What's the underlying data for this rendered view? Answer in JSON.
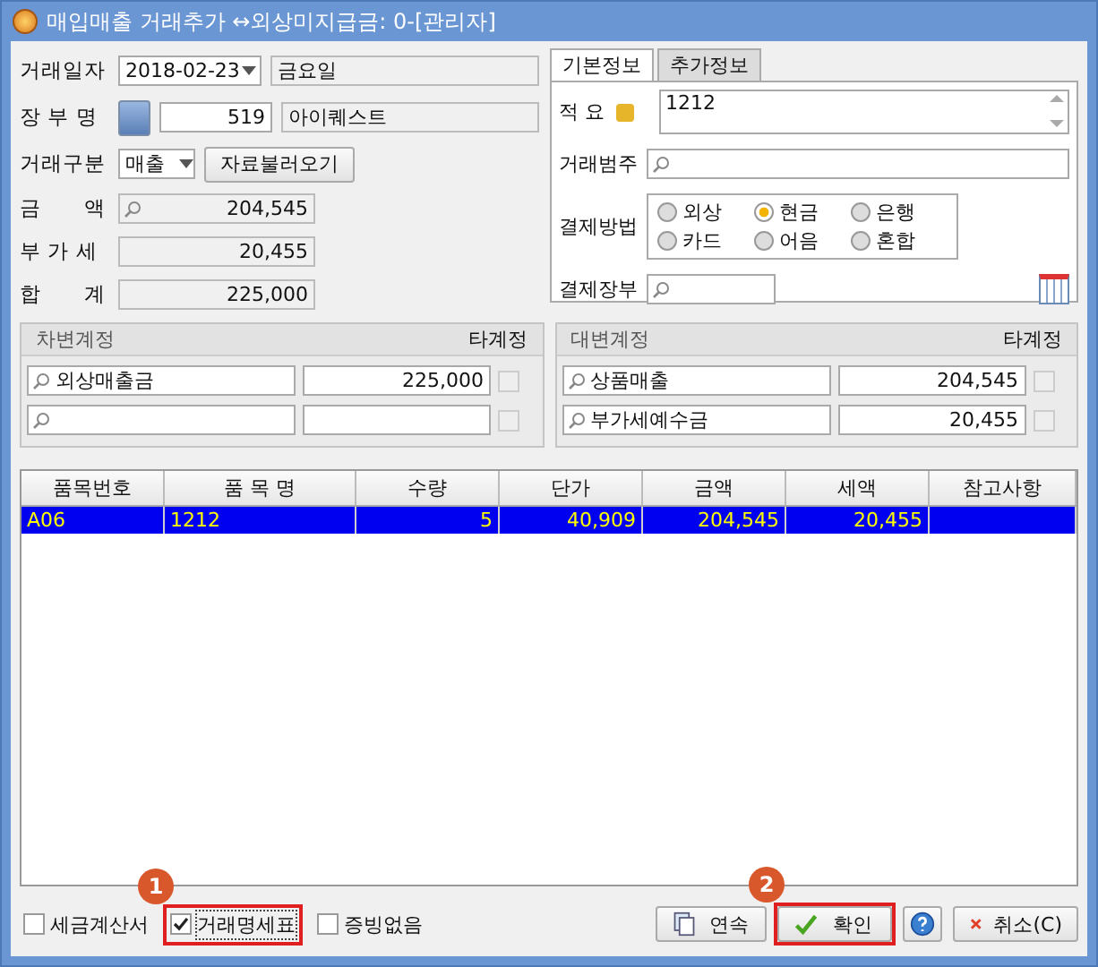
{
  "window": {
    "title": "매입매출 거래추가 ↔외상미지급금: 0-[관리자]"
  },
  "left": {
    "date_label": "거래일자",
    "date": "2018-02-23",
    "weekday": "금요일",
    "ledger_label": "장 부 명",
    "ledger_code": "519",
    "ledger_name": "아이퀘스트",
    "type_label": "거래구분",
    "type": "매출",
    "load_button": "자료불러오기",
    "amounts": [
      {
        "label": "금　　액",
        "value": "204,545",
        "search": true
      },
      {
        "label": "부 가 세",
        "value": "20,455",
        "search": false
      },
      {
        "label": "합　　계",
        "value": "225,000",
        "search": false
      }
    ]
  },
  "tabs": [
    {
      "label": "기본정보",
      "selected": true
    },
    {
      "label": "추가정보",
      "selected": false
    }
  ],
  "info": {
    "memo_label": "적 요",
    "memo": "1212",
    "category_label": "거래범주",
    "payment_label": "결제방법",
    "payment_methods": [
      {
        "label": "외상",
        "selected": false
      },
      {
        "label": "현금",
        "selected": true
      },
      {
        "label": "은행",
        "selected": false
      },
      {
        "label": "카드",
        "selected": false
      },
      {
        "label": "어음",
        "selected": false
      },
      {
        "label": "혼합",
        "selected": false
      }
    ],
    "payment_ledger_label": "결제장부"
  },
  "accounts": [
    {
      "title": "차변계정",
      "other_label": "타계정",
      "rows": [
        {
          "account": "외상매출금",
          "amount": "225,000",
          "checked": false
        },
        {
          "account": "",
          "amount": "",
          "checked": false
        }
      ]
    },
    {
      "title": "대변계정",
      "other_label": "타계정",
      "rows": [
        {
          "account": "상품매출",
          "amount": "204,545",
          "checked": false
        },
        {
          "account": "부가세예수금",
          "amount": "20,455",
          "checked": false
        }
      ]
    }
  ],
  "table": {
    "columns": [
      "품목번호",
      "품 목 명",
      "수량",
      "단가",
      "금액",
      "세액",
      "참고사항"
    ],
    "rows": [
      {
        "selected": true,
        "cells": [
          "A06",
          "1212",
          "5",
          "40,909",
          "204,545",
          "20,455",
          ""
        ]
      }
    ]
  },
  "footer": {
    "checkboxes": [
      {
        "label": "세금계산서",
        "checked": false
      },
      {
        "label": "거래명세표",
        "checked": true,
        "callout": "1"
      },
      {
        "label": "증빙없음",
        "checked": false
      }
    ],
    "buttons": [
      {
        "kind": "continue",
        "label": "연속"
      },
      {
        "kind": "ok",
        "label": "확인",
        "callout": "2"
      },
      {
        "kind": "help"
      },
      {
        "kind": "cancel",
        "label": "취소(C)"
      }
    ]
  }
}
